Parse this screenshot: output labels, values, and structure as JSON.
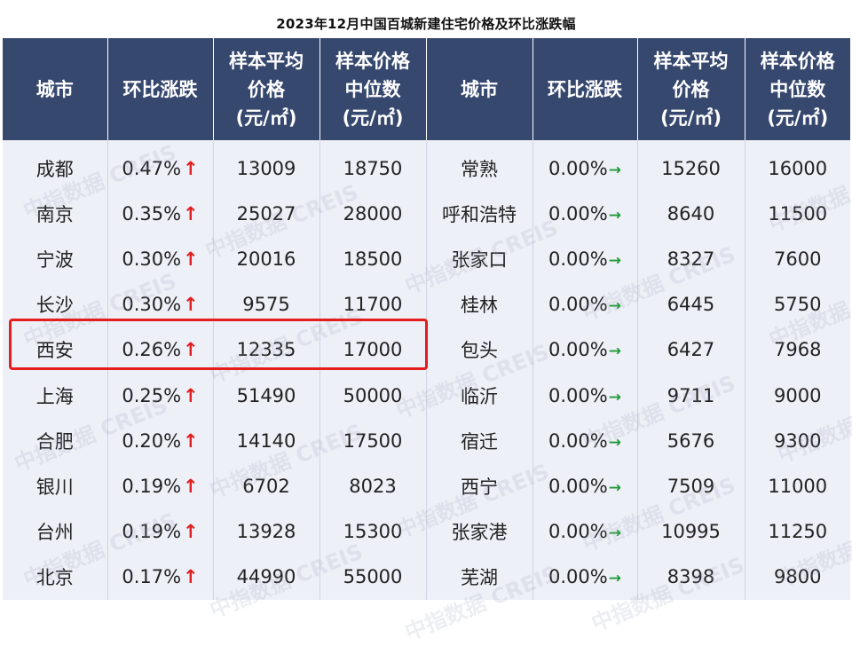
{
  "title": "2023年12月中国百城新建住宅价格及环比涨跌幅",
  "header": {
    "city": "城市",
    "mom": "环比涨跌",
    "avg_line1": "样本平均",
    "avg_line2": "价格",
    "median_line1": "样本价格",
    "median_line2": "中位数",
    "unit": "(元/㎡)"
  },
  "arrows": {
    "up": "↑",
    "flat": "→"
  },
  "watermark": "中指数据 CREIS",
  "colors": {
    "header_bg": "#37486f",
    "body_bg": "#eef0f7",
    "up_arrow": "#e02020",
    "flat_arrow": "#1f9a3a",
    "highlight": "#e41d1d"
  },
  "rows": [
    {
      "left_city": "成都",
      "left_mom": "0.47%",
      "left_avg": "13009",
      "left_median": "18750",
      "right_city": "常熟",
      "right_mom": "0.00%",
      "right_avg": "15260",
      "right_median": "16000"
    },
    {
      "left_city": "南京",
      "left_mom": "0.35%",
      "left_avg": "25027",
      "left_median": "28000",
      "right_city": "呼和浩特",
      "right_mom": "0.00%",
      "right_avg": "8640",
      "right_median": "11500"
    },
    {
      "left_city": "宁波",
      "left_mom": "0.30%",
      "left_avg": "20016",
      "left_median": "18500",
      "right_city": "张家口",
      "right_mom": "0.00%",
      "right_avg": "8327",
      "right_median": "7600"
    },
    {
      "left_city": "长沙",
      "left_mom": "0.30%",
      "left_avg": "9575",
      "left_median": "11700",
      "right_city": "桂林",
      "right_mom": "0.00%",
      "right_avg": "6445",
      "right_median": "5750"
    },
    {
      "left_city": "西安",
      "left_mom": "0.26%",
      "left_avg": "12335",
      "left_median": "17000",
      "right_city": "包头",
      "right_mom": "0.00%",
      "right_avg": "6427",
      "right_median": "7968"
    },
    {
      "left_city": "上海",
      "left_mom": "0.25%",
      "left_avg": "51490",
      "left_median": "50000",
      "right_city": "临沂",
      "right_mom": "0.00%",
      "right_avg": "9711",
      "right_median": "9000"
    },
    {
      "left_city": "合肥",
      "left_mom": "0.20%",
      "left_avg": "14140",
      "left_median": "17500",
      "right_city": "宿迁",
      "right_mom": "0.00%",
      "right_avg": "5676",
      "right_median": "9300"
    },
    {
      "left_city": "银川",
      "left_mom": "0.19%",
      "left_avg": "6702",
      "left_median": "8023",
      "right_city": "西宁",
      "right_mom": "0.00%",
      "right_avg": "7509",
      "right_median": "11000"
    },
    {
      "left_city": "台州",
      "left_mom": "0.19%",
      "left_avg": "13928",
      "left_median": "15300",
      "right_city": "张家港",
      "right_mom": "0.00%",
      "right_avg": "10995",
      "right_median": "11250"
    },
    {
      "left_city": "北京",
      "left_mom": "0.17%",
      "left_avg": "44990",
      "left_median": "55000",
      "right_city": "芜湖",
      "right_mom": "0.00%",
      "right_avg": "8398",
      "right_median": "9800"
    }
  ]
}
